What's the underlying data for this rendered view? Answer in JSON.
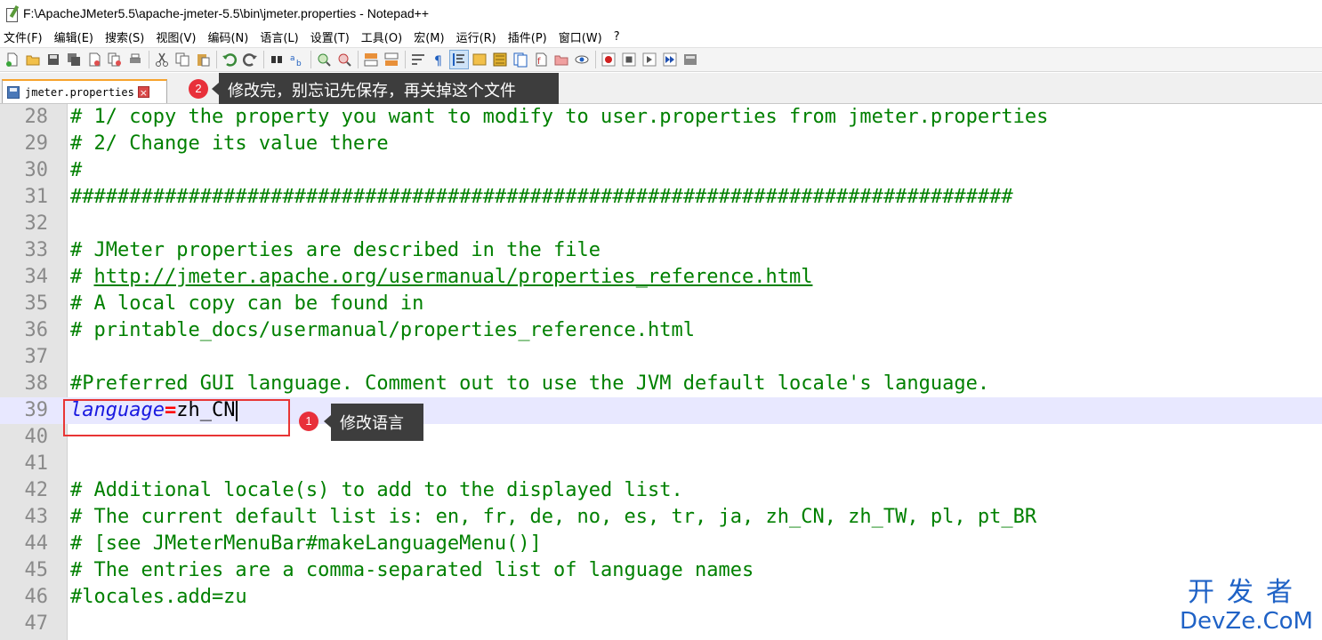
{
  "window": {
    "title": "F:\\ApacheJMeter5.5\\apache-jmeter-5.5\\bin\\jmeter.properties - Notepad++"
  },
  "menu": [
    "文件(F)",
    "编辑(E)",
    "搜索(S)",
    "视图(V)",
    "编码(N)",
    "语言(L)",
    "设置(T)",
    "工具(O)",
    "宏(M)",
    "运行(R)",
    "插件(P)",
    "窗口(W)",
    "?"
  ],
  "toolbar": {
    "buttons": [
      "new-file-icon",
      "open-file-icon",
      "save-icon",
      "save-all-icon",
      "close-icon",
      "close-all-icon",
      "print-icon",
      "cut-icon",
      "copy-icon",
      "paste-icon",
      "undo-icon",
      "redo-icon",
      "find-icon",
      "replace-icon",
      "zoom-in-icon",
      "zoom-out-icon",
      "sync-vertical-icon",
      "sync-horizontal-icon",
      "word-wrap-icon",
      "show-all-chars-icon",
      "indent-guide-icon",
      "udl-icon",
      "document-map-icon",
      "function-list-icon",
      "folder-as-workspace-icon",
      "monitoring-icon",
      "record-macro-icon",
      "stop-macro-icon",
      "play-macro-icon",
      "run-macro-multiple-icon",
      "save-macro-icon"
    ]
  },
  "tab": {
    "label": "jmeter.properties",
    "close_glyph": "×"
  },
  "callouts": {
    "one": {
      "num": "1",
      "text": "修改语言"
    },
    "two": {
      "num": "2",
      "text": "修改完，别忘记先保存，再关掉这个文件"
    }
  },
  "editor": {
    "current_line": "39",
    "lines": [
      {
        "n": "28",
        "text": "# 1/ copy the property you want to modify to user.properties from jmeter.properties"
      },
      {
        "n": "29",
        "text": "# 2/ Change its value there"
      },
      {
        "n": "30",
        "text": "#"
      },
      {
        "n": "31",
        "text": "################################################################################"
      },
      {
        "n": "32",
        "text": ""
      },
      {
        "n": "33",
        "text": "# JMeter properties are described in the file"
      },
      {
        "n": "34",
        "prefix": "# ",
        "url": "http://jmeter.apache.org/usermanual/properties_reference.html"
      },
      {
        "n": "35",
        "text": "# A local copy can be found in"
      },
      {
        "n": "36",
        "text": "# printable_docs/usermanual/properties_reference.html"
      },
      {
        "n": "37",
        "text": ""
      },
      {
        "n": "38",
        "text": "#Preferred GUI language. Comment out to use the JVM default locale's language."
      },
      {
        "n": "39",
        "key": "language",
        "eq": "=",
        "value": "zh_CN"
      },
      {
        "n": "40",
        "text": ""
      },
      {
        "n": "41",
        "text": ""
      },
      {
        "n": "42",
        "text": "# Additional locale(s) to add to the displayed list."
      },
      {
        "n": "43",
        "text": "# The current default list is: en, fr, de, no, es, tr, ja, zh_CN, zh_TW, pl, pt_BR"
      },
      {
        "n": "44",
        "text": "# [see JMeterMenuBar#makeLanguageMenu()]"
      },
      {
        "n": "45",
        "text": "# The entries are a comma-separated list of language names"
      },
      {
        "n": "46",
        "text": "#locales.add=zu"
      },
      {
        "n": "47",
        "text": ""
      }
    ]
  },
  "watermark": {
    "cn": "开发者",
    "en": "DevZe.CoM"
  },
  "colors": {
    "comment": "#008000",
    "key": "#1a1ae0",
    "operator": "#ff0000",
    "current_line": "#e8e8ff",
    "callout_red": "#e8303a",
    "callout_bg": "#3d3d3d",
    "watermark": "#1f62c6"
  }
}
